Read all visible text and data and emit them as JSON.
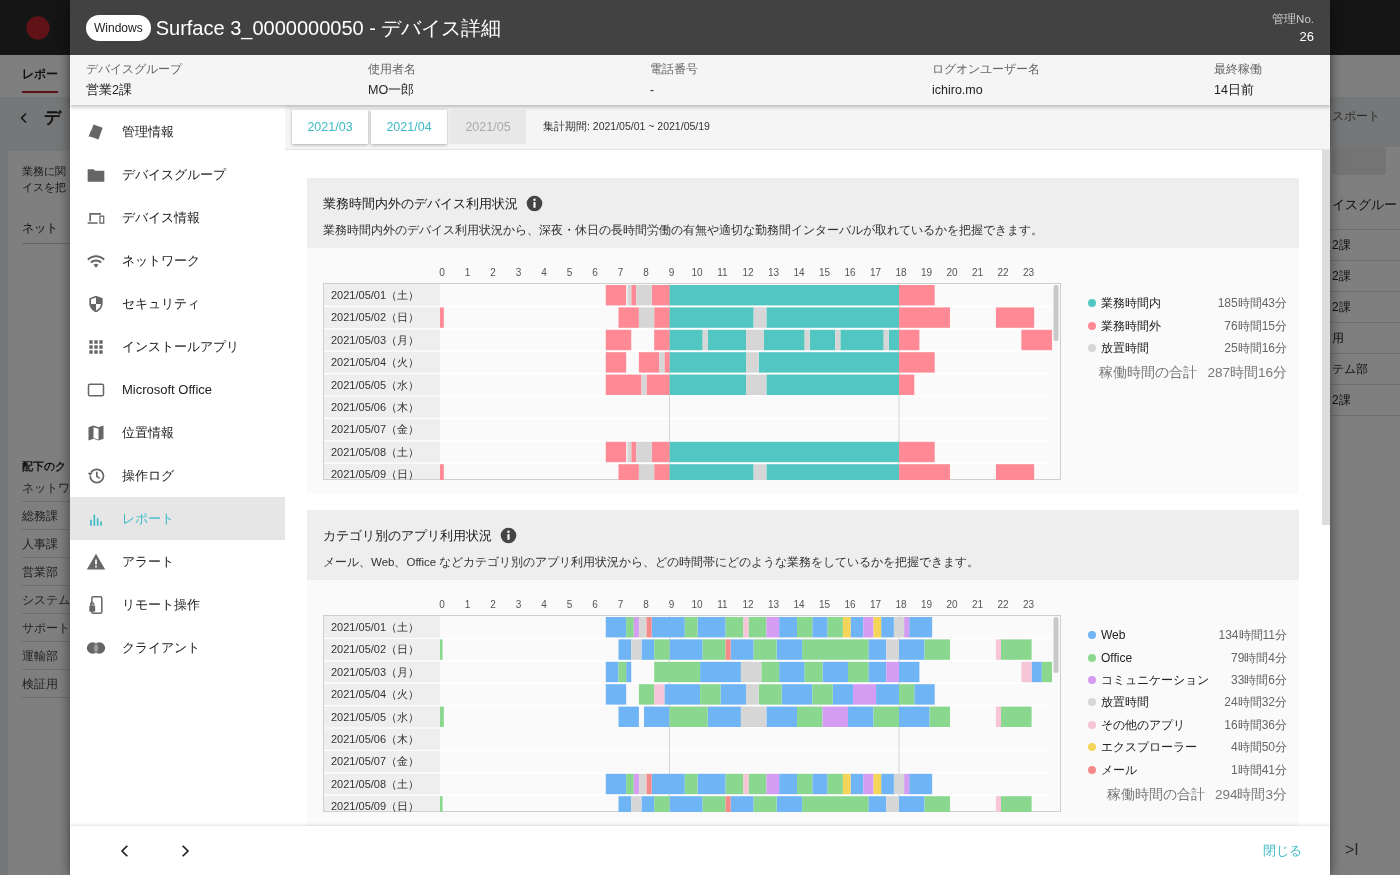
{
  "background_page": {
    "tab": "レポー",
    "title": "デ",
    "description_lines": [
      "業務に関",
      "イスを把"
    ],
    "field": "ネット",
    "list_heading": "配下のク",
    "left_list": [
      "ネットワ",
      "総務課",
      "人事課",
      "営業部",
      "システム",
      "サポート",
      "運輸部",
      "検証用"
    ],
    "right_header": "スポート",
    "right_list_heading": "イスグルー",
    "right_list": [
      "2課",
      "2課",
      "2課",
      "用",
      "テム部",
      "2課"
    ],
    "pager": ">I"
  },
  "modal": {
    "os_badge": "Windows",
    "title": "Surface 3_0000000050 - デバイス詳細",
    "management_no": {
      "label": "管理No.",
      "value": "26"
    },
    "info": [
      {
        "label": "デバイスグループ",
        "value": "営業2課"
      },
      {
        "label": "使用者名",
        "value": "MO一郎"
      },
      {
        "label": "電話番号",
        "value": "-"
      },
      {
        "label": "ログオンユーザー名",
        "value": "ichiro.mo"
      },
      {
        "label": "最終稼働",
        "value": "14日前"
      }
    ],
    "nav": [
      {
        "label": "管理情報",
        "kind": "tag",
        "selected": false
      },
      {
        "label": "デバイスグループ",
        "kind": "folder",
        "selected": false
      },
      {
        "label": "デバイス情報",
        "kind": "devices",
        "selected": false
      },
      {
        "label": "ネットワーク",
        "kind": "wifi",
        "selected": false
      },
      {
        "label": "セキュリティ",
        "kind": "shield",
        "selected": false
      },
      {
        "label": "インストールアプリ",
        "kind": "apps",
        "selected": false
      },
      {
        "label": "Microsoft Office",
        "kind": "window",
        "selected": false
      },
      {
        "label": "位置情報",
        "kind": "map",
        "selected": false
      },
      {
        "label": "操作ログ",
        "kind": "history",
        "selected": false
      },
      {
        "label": "レポート",
        "kind": "chart",
        "selected": true
      },
      {
        "label": "アラート",
        "kind": "alert",
        "selected": false
      },
      {
        "label": "リモート操作",
        "kind": "remote",
        "selected": false
      },
      {
        "label": "クライアント",
        "kind": "client",
        "selected": false
      }
    ],
    "months": [
      {
        "label": "2021/03",
        "selected": false
      },
      {
        "label": "2021/04",
        "selected": false
      },
      {
        "label": "2021/05",
        "selected": true
      }
    ],
    "period": "集計期間: 2021/05/01 ~ 2021/05/19",
    "sections": [
      {
        "title": "業務時間内外のデバイス利用状況",
        "description": "業務時間内外のデバイス利用状況から、深夜・休日の長時間労働の有無や適切な勤務間インターバルが取れているかを把握できます。",
        "hours": [
          "0",
          "1",
          "2",
          "3",
          "4",
          "5",
          "6",
          "7",
          "8",
          "9",
          "10",
          "11",
          "12",
          "13",
          "14",
          "15",
          "16",
          "17",
          "18",
          "19",
          "20",
          "21",
          "22",
          "23"
        ],
        "rows": [
          "2021/05/01（土）",
          "2021/05/02（日）",
          "2021/05/03（月）",
          "2021/05/04（火）",
          "2021/05/05（水）",
          "2021/05/06（木）",
          "2021/05/07（金）",
          "2021/05/08（土）",
          "2021/05/09（日）"
        ],
        "legend": [
          {
            "name": "業務時間内",
            "color": "#52c7c2",
            "total": "185時間43分"
          },
          {
            "name": "業務時間外",
            "color": "#ff8a96",
            "total": "76時間15分"
          },
          {
            "name": "放置時間",
            "color": "#d6d6d6",
            "total": "25時間16分"
          }
        ],
        "total_label": "稼働時間の合計",
        "total_value": "287時間16分"
      },
      {
        "title": "カテゴリ別のアプリ利用状況",
        "description": "メール、Web、Office などカテゴリ別のアプリ利用状況から、どの時間帯にどのような業務をしているかを把握できます。",
        "hours": [
          "0",
          "1",
          "2",
          "3",
          "4",
          "5",
          "6",
          "7",
          "8",
          "9",
          "10",
          "11",
          "12",
          "13",
          "14",
          "15",
          "16",
          "17",
          "18",
          "19",
          "20",
          "21",
          "22",
          "23"
        ],
        "rows": [
          "2021/05/01（土）",
          "2021/05/02（日）",
          "2021/05/03（月）",
          "2021/05/04（火）",
          "2021/05/05（水）",
          "2021/05/06（木）",
          "2021/05/07（金）",
          "2021/05/08（土）",
          "2021/05/09（日）"
        ],
        "legend": [
          {
            "name": "Web",
            "color": "#6fb4f5",
            "total": "134時間11分"
          },
          {
            "name": "Office",
            "color": "#8ad88f",
            "total": "79時間4分"
          },
          {
            "name": "コミュニケーション",
            "color": "#d49cf2",
            "total": "33時間6分"
          },
          {
            "name": "放置時間",
            "color": "#d6d6d6",
            "total": "24時間32分"
          },
          {
            "name": "その他のアプリ",
            "color": "#f6c6d8",
            "total": "16時間36分"
          },
          {
            "name": "エクスプローラー",
            "color": "#f5d45a",
            "total": "4時間50分"
          },
          {
            "name": "メール",
            "color": "#f58a8a",
            "total": "1時間41分"
          }
        ],
        "total_label": "稼働時間の合計",
        "total_value": "294時間3分"
      }
    ],
    "close_button": "閉じる"
  }
}
